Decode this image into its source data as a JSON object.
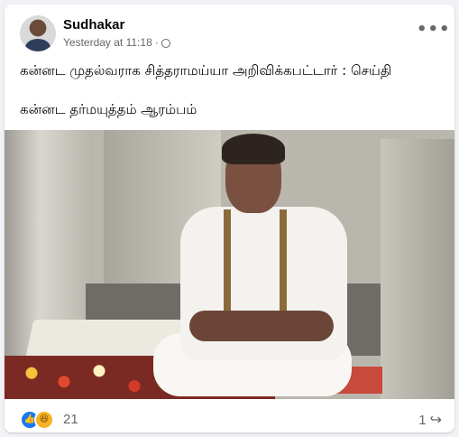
{
  "post": {
    "author": "Sudhakar",
    "timestamp": "Yesterday at 11:18",
    "audience_icon": "globe-icon",
    "more_icon": "more-options-icon",
    "text_line1": "கன்னட முதல்வராக சித்தராமய்யா அறிவிக்கபட்டார் : செய்தி",
    "text_line2": "கன்னட தர்மயுத்தம் ஆரம்பம்"
  },
  "footer": {
    "reaction_count": "21",
    "reaction_icons": [
      "like-icon",
      "haha-icon"
    ],
    "share_count": "1",
    "share_icon": "share-arrow-icon"
  },
  "colors": {
    "background": "#f0f2f5",
    "card": "#ffffff",
    "text_primary": "#050505",
    "text_secondary": "#65676b",
    "like_blue": "#1877f2"
  }
}
